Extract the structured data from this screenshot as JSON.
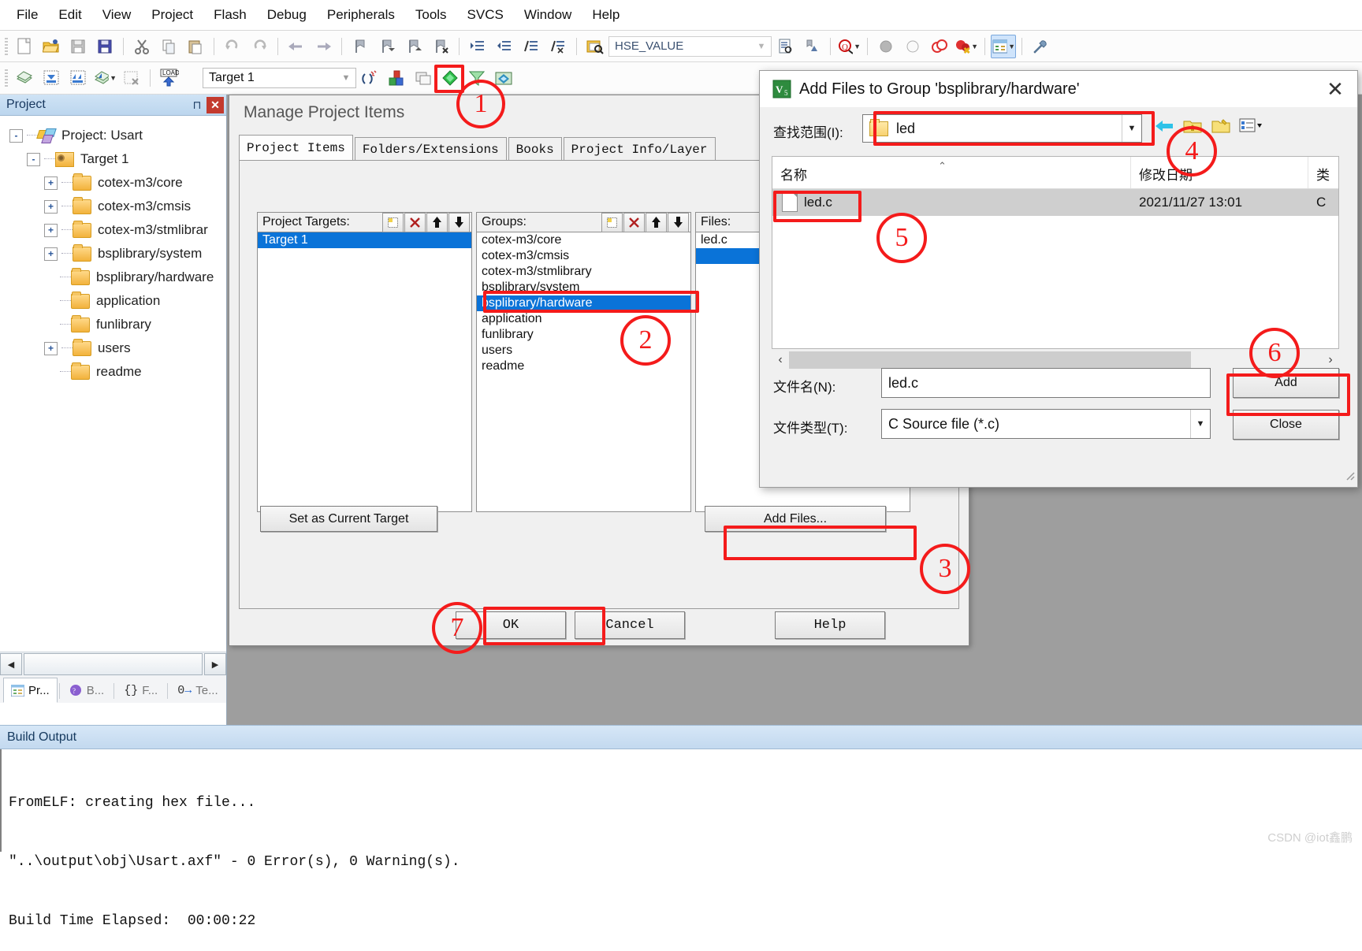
{
  "menu": {
    "items": [
      "File",
      "Edit",
      "View",
      "Project",
      "Flash",
      "Debug",
      "Peripherals",
      "Tools",
      "SVCS",
      "Window",
      "Help"
    ]
  },
  "toolbar": {
    "target_value": "Target 1",
    "hse_value": "HSE_VALUE"
  },
  "project_pane": {
    "title": "Project",
    "pin_icon": "pin-icon",
    "close_icon": "close-icon",
    "tree": [
      {
        "label": "Project: Usart",
        "toggle": "-",
        "depth": 0,
        "icon": "project-icon"
      },
      {
        "label": "Target 1",
        "toggle": "-",
        "depth": 1,
        "icon": "target-icon"
      },
      {
        "label": "cotex-m3/core",
        "toggle": "+",
        "depth": 2,
        "icon": "folder-icon"
      },
      {
        "label": "cotex-m3/cmsis",
        "toggle": "+",
        "depth": 2,
        "icon": "folder-icon"
      },
      {
        "label": "cotex-m3/stmlibrar",
        "toggle": "+",
        "depth": 2,
        "icon": "folder-icon"
      },
      {
        "label": "bsplibrary/system",
        "toggle": "+",
        "depth": 2,
        "icon": "folder-icon"
      },
      {
        "label": "bsplibrary/hardware",
        "toggle": "",
        "depth": 2,
        "icon": "folder-icon"
      },
      {
        "label": "application",
        "toggle": "",
        "depth": 2,
        "icon": "folder-icon"
      },
      {
        "label": "funlibrary",
        "toggle": "",
        "depth": 2,
        "icon": "folder-icon"
      },
      {
        "label": "users",
        "toggle": "+",
        "depth": 2,
        "icon": "folder-icon"
      },
      {
        "label": "readme",
        "toggle": "",
        "depth": 2,
        "icon": "folder-icon"
      }
    ],
    "tabs": [
      {
        "label": "Pr...",
        "icon": "project-window-icon",
        "active": true
      },
      {
        "label": "B...",
        "icon": "books-icon",
        "active": false
      },
      {
        "label": "F...",
        "icon": "functions-icon",
        "active": false
      },
      {
        "label": "Te...",
        "icon": "templates-icon",
        "active": false
      }
    ]
  },
  "manage_dialog": {
    "title": "Manage Project Items",
    "tabs": [
      "Project Items",
      "Folders/Extensions",
      "Books",
      "Project Info/Layer"
    ],
    "active_tab": "Project Items",
    "targets": {
      "label": "Project Targets:",
      "items": [
        "Target 1"
      ],
      "selected": "Target 1",
      "buttons": [
        "new-icon",
        "delete-icon",
        "move-up-icon",
        "move-down-icon"
      ]
    },
    "groups": {
      "label": "Groups:",
      "items": [
        "cotex-m3/core",
        "cotex-m3/cmsis",
        "cotex-m3/stmlibrary",
        "bsplibrary/system",
        "bsplibrary/hardware",
        "application",
        "funlibrary",
        "users",
        "readme"
      ],
      "selected": "bsplibrary/hardware",
      "buttons": [
        "new-icon",
        "delete-icon",
        "move-up-icon",
        "move-down-icon"
      ]
    },
    "files": {
      "label": "Files:",
      "items": [
        "led.c"
      ],
      "selected": ""
    },
    "set_current_target": "Set as Current Target",
    "add_files": "Add Files...",
    "ok": "OK",
    "cancel": "Cancel",
    "help": "Help"
  },
  "add_files_dialog": {
    "title": "Add Files to Group 'bsplibrary/hardware'",
    "app_icon": "keil-icon",
    "close_icon": "close-icon",
    "lookin_label": "查找范围(I):",
    "lookin_value": "led",
    "nav_icons": [
      "back-arrow-icon",
      "up-folder-icon",
      "new-folder-icon",
      "view-list-icon"
    ],
    "columns": [
      "名称",
      "修改日期",
      "类"
    ],
    "rows": [
      {
        "name": "led.c",
        "modified": "2021/11/27 13:01",
        "type": "C "
      }
    ],
    "filename_label": "文件名(N):",
    "filename_value": "led.c",
    "filetype_label": "文件类型(T):",
    "filetype_value": "C Source file (*.c)",
    "add_button": "Add",
    "close_button": "Close"
  },
  "build_output": {
    "title": "Build Output",
    "lines": [
      "FromELF: creating hex file...",
      "\"..\\output\\obj\\Usart.axf\" - 0 Error(s), 0 Warning(s).",
      "Build Time Elapsed:  00:00:22"
    ]
  },
  "annotations": {
    "steps": [
      "1",
      "2",
      "3",
      "4",
      "5",
      "6",
      "7"
    ],
    "color": "#f41b1b"
  },
  "watermark": "CSDN @iot鑫鹏"
}
